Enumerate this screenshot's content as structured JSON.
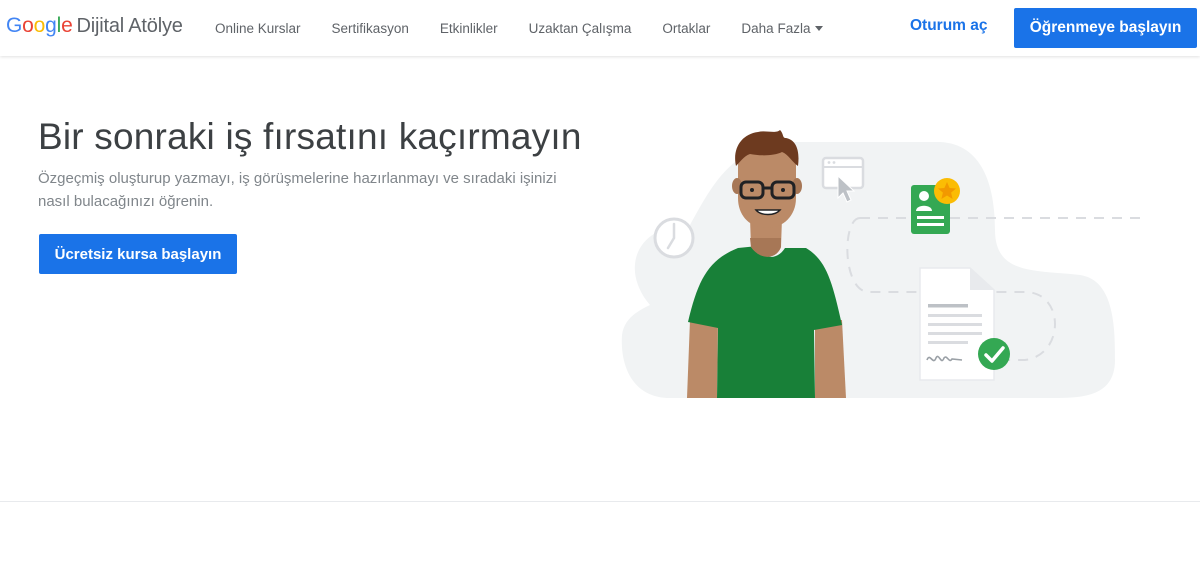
{
  "header": {
    "logo": {
      "google_letters": [
        "G",
        "o",
        "o",
        "g",
        "l",
        "e"
      ],
      "product": "Dijital Atölye"
    },
    "nav": [
      {
        "label": "Online Kurslar"
      },
      {
        "label": "Sertifikasyon"
      },
      {
        "label": "Etkinlikler"
      },
      {
        "label": "Uzaktan Çalışma"
      },
      {
        "label": "Ortaklar"
      },
      {
        "label": "Daha Fazla"
      }
    ],
    "signin_label": "Oturum aç",
    "cta_label": "Öğrenmeye başlayın"
  },
  "hero": {
    "title": "Bir sonraki iş fırsatını kaçırmayın",
    "description": "Özgeçmiş oluşturup yazmayı, iş görüşmelerine hazırlanmayı ve sıradaki işinizi nasıl bulacağınızı öğrenin.",
    "cta_label": "Ücretsiz kursa başlayın"
  },
  "colors": {
    "accent": "#1a73e8",
    "title_text": "#3c4043",
    "muted_text": "#80868b",
    "shirt_green": "#188038",
    "badge_star": "#fbbc04"
  },
  "icons": {
    "nav_more": "caret-down-icon",
    "illustration": [
      "clock-icon",
      "browser-cursor-icon",
      "profile-card-icon",
      "star-badge-icon",
      "resume-document-icon",
      "checkmark-icon"
    ]
  }
}
